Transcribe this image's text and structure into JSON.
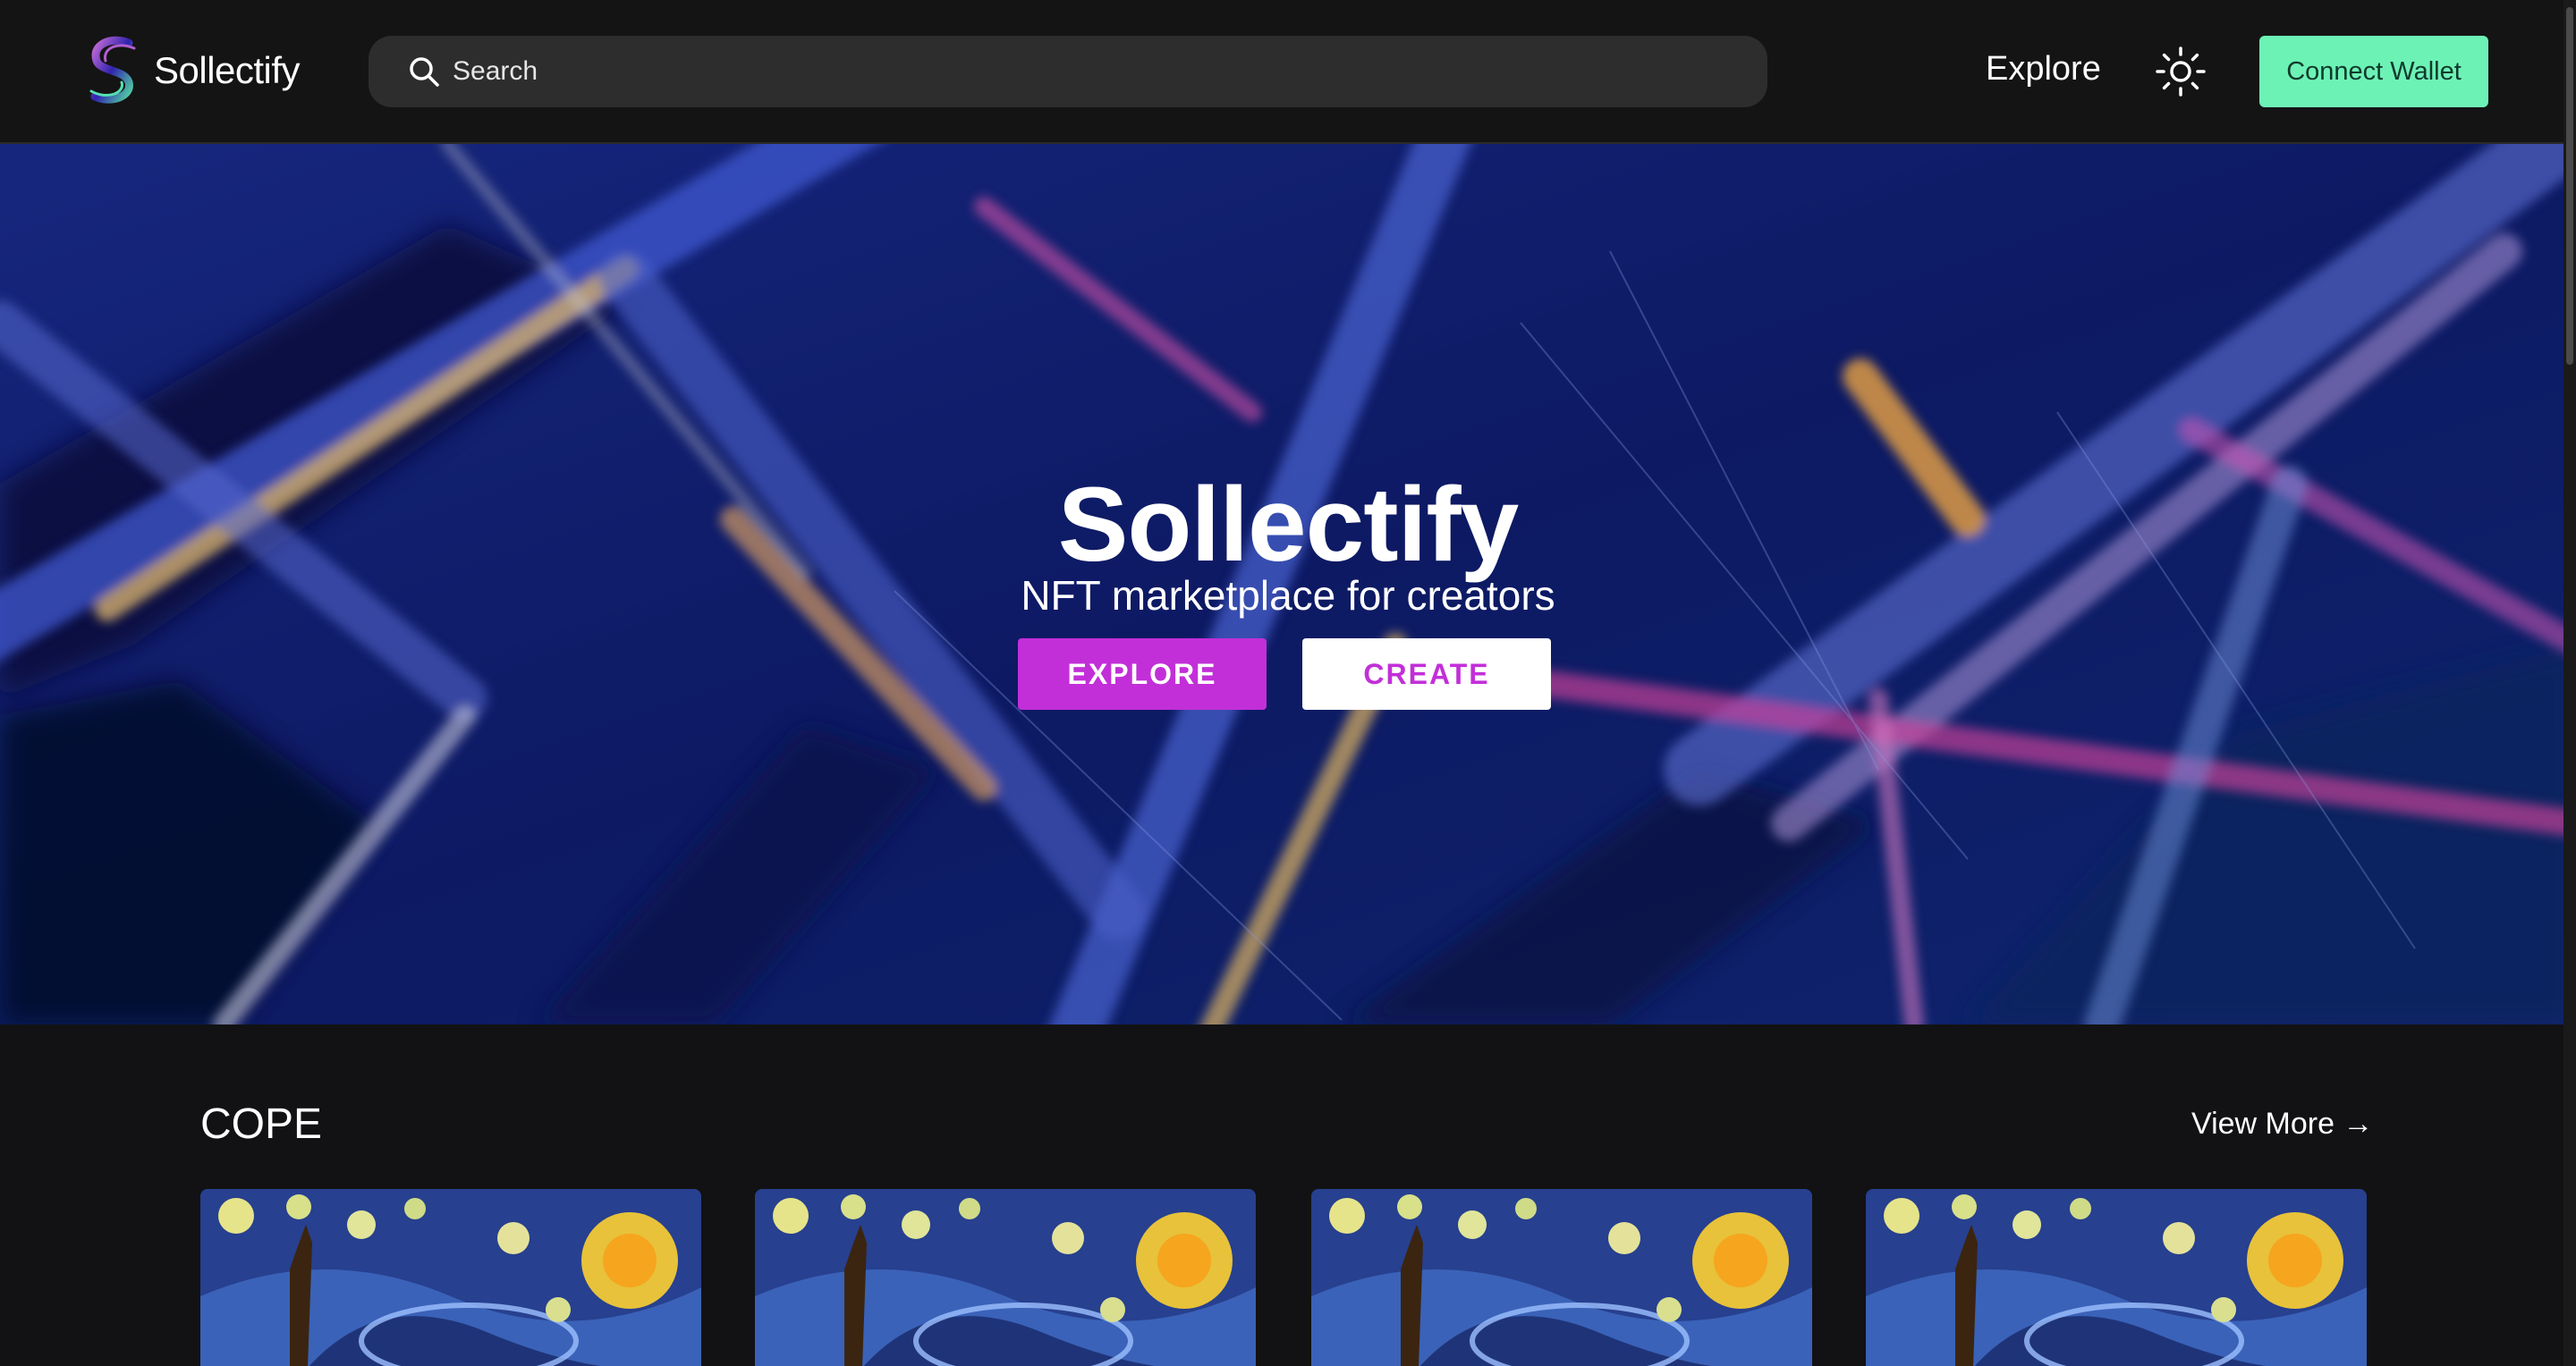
{
  "header": {
    "brand": "Sollectify",
    "search_placeholder": "Search",
    "nav_explore": "Explore",
    "connect_wallet": "Connect Wallet",
    "theme_icon": "sun-icon"
  },
  "hero": {
    "title": "Sollectify",
    "subtitle": "NFT marketplace for creators",
    "explore_button": "EXPLORE",
    "create_button": "CREATE"
  },
  "collection": {
    "title": "COPE",
    "view_more": "View More →",
    "cards": [
      {
        "image": "starry-night-artwork"
      },
      {
        "image": "starry-night-artwork"
      },
      {
        "image": "starry-night-artwork"
      },
      {
        "image": "starry-night-artwork"
      }
    ]
  },
  "colors": {
    "accent_green": "#6df2b6",
    "accent_purple": "#c22fd8",
    "background": "#121214"
  }
}
